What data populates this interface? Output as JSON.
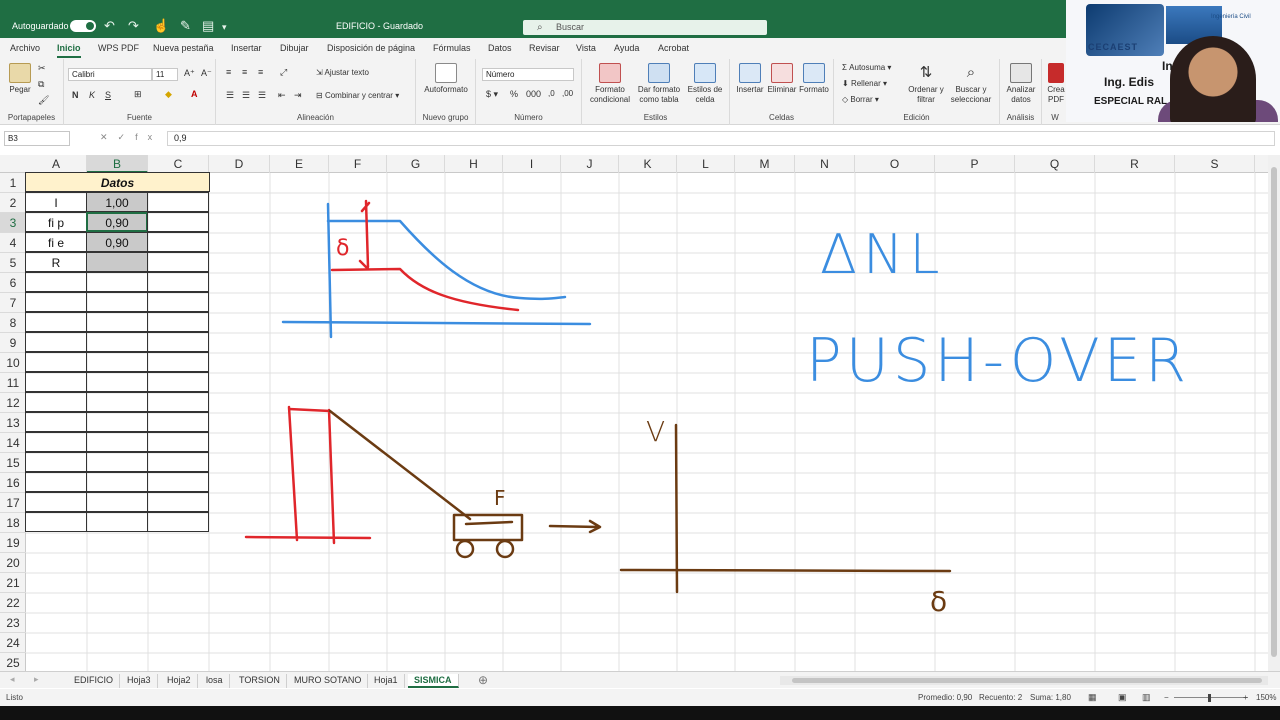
{
  "window": {
    "autosave_label": "Autoguardado",
    "doc_title": "EDIFICIO - Guardado",
    "search_placeholder": "Buscar"
  },
  "menu_tabs": [
    "Archivo",
    "Inicio",
    "WPS PDF",
    "Nueva pestaña",
    "Insertar",
    "Dibujar",
    "Disposición de página",
    "Fórmulas",
    "Datos",
    "Revisar",
    "Vista",
    "Ayuda",
    "Acrobat"
  ],
  "active_tab": "Inicio",
  "ribbon": {
    "portapapeles": {
      "label": "Portapapeles",
      "paste": "Pegar"
    },
    "fuente": {
      "label": "Fuente",
      "font": "Calibri",
      "size": "11"
    },
    "alineacion": {
      "label": "Alineación",
      "wrap": "Ajustar texto",
      "merge": "Combinar y centrar"
    },
    "nuevo_grupo": {
      "label": "Nuevo grupo",
      "autoformat": "Autoformato"
    },
    "numero": {
      "label": "Número",
      "format": "Número"
    },
    "estilos": {
      "label": "Estilos",
      "cond": "Formato condicional",
      "table": "Dar formato como tabla",
      "cell": "Estilos de celda"
    },
    "celdas": {
      "label": "Celdas",
      "insert": "Insertar",
      "delete": "Eliminar",
      "format": "Formato"
    },
    "edicion": {
      "label": "Edición",
      "autosum": "Autosuma",
      "fill": "Rellenar",
      "clear": "Borrar",
      "sort": "Ordenar y filtrar",
      "find": "Buscar y seleccionar"
    },
    "analisis": {
      "label": "Análisis",
      "analyze": "Analizar datos"
    },
    "pdf": {
      "create": "Crea PDF",
      "w": "W"
    }
  },
  "formula_bar": {
    "name_box": "B3",
    "value": "0,9"
  },
  "columns": [
    "A",
    "B",
    "C",
    "D",
    "E",
    "F",
    "G",
    "H",
    "I",
    "J",
    "K",
    "L",
    "M",
    "N",
    "O",
    "P",
    "Q",
    "R",
    "S"
  ],
  "rows": [
    "1",
    "2",
    "3",
    "4",
    "5",
    "6",
    "7",
    "8",
    "9",
    "10",
    "11",
    "12",
    "13",
    "14",
    "15",
    "16",
    "17",
    "18",
    "19",
    "20",
    "21",
    "22",
    "23",
    "24",
    "25"
  ],
  "table": {
    "header": "Datos",
    "rows": [
      {
        "label": "I",
        "value": "1,00"
      },
      {
        "label": "fi p",
        "value": "0,90"
      },
      {
        "label": "fi e",
        "value": "0,90"
      },
      {
        "label": "R",
        "value": ""
      }
    ]
  },
  "ink_text": {
    "anl": "ΔNL",
    "pushover": "PUSH-OVER",
    "v_axis": "V",
    "force": "F",
    "delta": "δ",
    "r_factor": "δ"
  },
  "sheets": [
    "EDIFICIO",
    "Hoja3",
    "Hoja2",
    "losa",
    "TORSION",
    "MURO SOTANO",
    "Hoja1",
    "SISMICA"
  ],
  "active_sheet": "SISMICA",
  "status": {
    "mode": "Listo",
    "average": "Promedio: 0,90",
    "count": "Recuento: 2",
    "sum": "Suma: 1,80",
    "zoom": "150%"
  },
  "webcam": {
    "brand": "CECAEST",
    "tagline": "Ingeniería Civil",
    "line1": "Instr",
    "line2": "Ing. Edis",
    "line3": "ESPECIAL          RAL"
  },
  "colors": {
    "excel_green": "#1f6e43",
    "ink_blue": "#3b8de0",
    "ink_red": "#e0262b",
    "ink_brown": "#6b3b12",
    "header_fill": "#fff2cc",
    "value_fill": "#c9c9c9"
  }
}
